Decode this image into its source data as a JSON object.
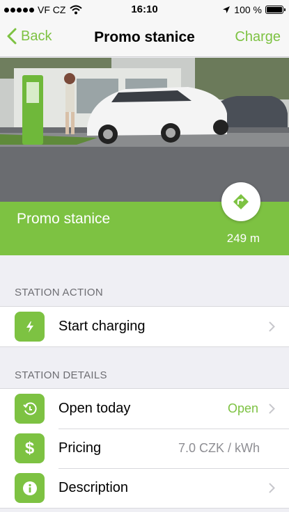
{
  "status_bar": {
    "carrier": "VF CZ",
    "time": "16:10",
    "battery": "100 %"
  },
  "nav": {
    "back_label": "Back",
    "title": "Promo stanice",
    "action_label": "Charge"
  },
  "station": {
    "name": "Promo stanice",
    "distance": "249 m"
  },
  "sections": {
    "action_header": "STATION ACTION",
    "details_header": "STATION DETAILS"
  },
  "rows": {
    "start_charging": "Start charging",
    "open_today": "Open today",
    "open_status": "Open",
    "pricing": "Pricing",
    "pricing_value": "7.0 CZK / kWh",
    "description": "Description"
  },
  "colors": {
    "accent": "#7dc242",
    "background": "#efeff4",
    "secondary_text": "#8e8e93"
  },
  "icons": {
    "back": "chevron-left-icon",
    "navigate": "directions-icon",
    "charge": "lightning-icon",
    "hours": "clock-icon",
    "pricing": "dollar-icon",
    "description": "info-icon",
    "disclosure": "chevron-right-icon"
  }
}
